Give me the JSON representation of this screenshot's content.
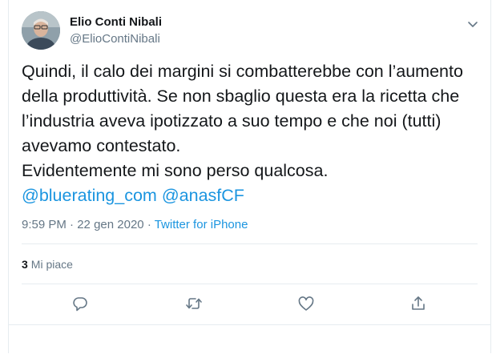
{
  "author": {
    "name": "Elio Conti Nibali",
    "handle": "@ElioContiNibali"
  },
  "tweet": {
    "text": "Quindi, il calo dei margini si combatterebbe con l’aumento\ndella produttività. Se non sbaglio questa era la ricetta che\nl’industria aveva ipotizzato a suo tempo e che noi (tutti)\navevamo contestato.\nEvidentemente mi sono perso qualcosa.",
    "mentions": [
      "@bluerating_com",
      "@anasfCF"
    ]
  },
  "meta": {
    "time": "9:59 PM",
    "separator": "·",
    "date": "22 gen 2020",
    "source": "Twitter for iPhone"
  },
  "stats": {
    "likes_count": "3",
    "likes_label": "Mi piace"
  },
  "actions": {
    "icons": [
      "reply-icon",
      "retweet-icon",
      "like-icon",
      "share-icon"
    ]
  },
  "colors": {
    "link": "#1b95e0",
    "secondary": "#657786",
    "border": "#e6ecf0",
    "text": "#14171a"
  }
}
